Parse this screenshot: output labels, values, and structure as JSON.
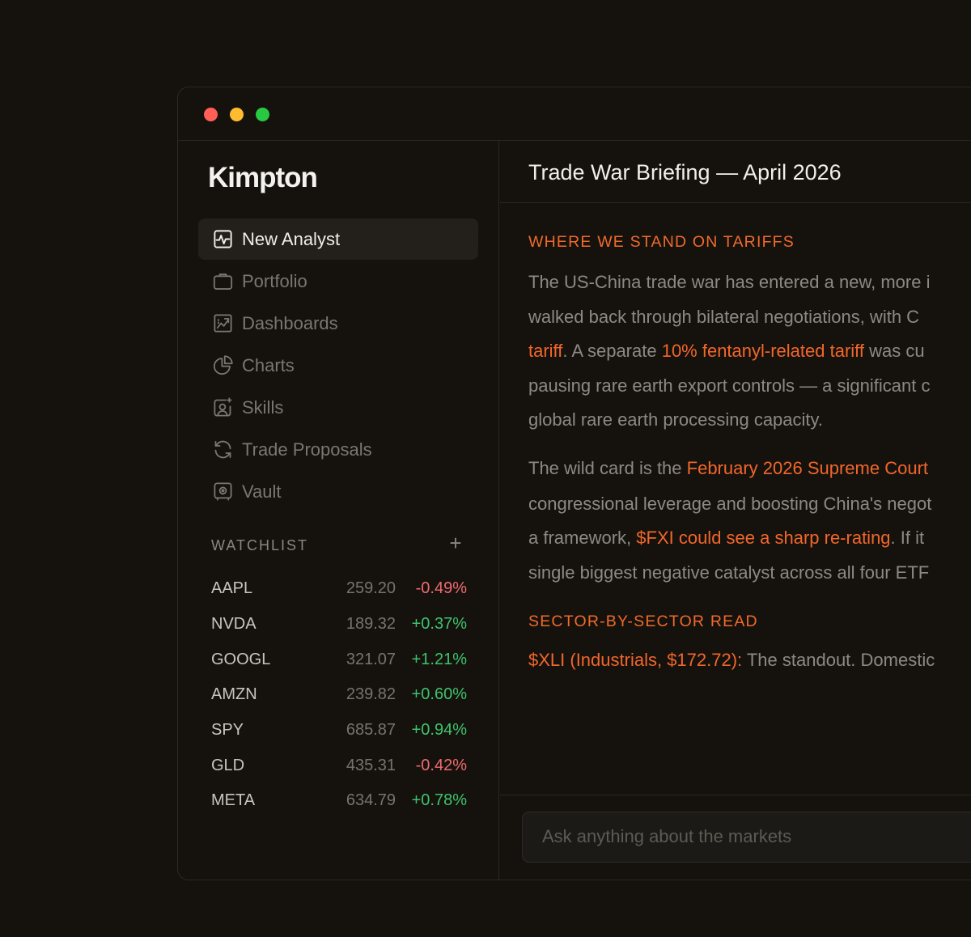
{
  "window": {
    "traffic_lights": [
      "close",
      "minimize",
      "zoom"
    ]
  },
  "sidebar": {
    "logo": "Kimpton",
    "nav": [
      {
        "label": "New Analyst",
        "icon": "chart-line-icon",
        "active": true
      },
      {
        "label": "Portfolio",
        "icon": "briefcase-icon"
      },
      {
        "label": "Dashboards",
        "icon": "dashboard-icon"
      },
      {
        "label": "Charts",
        "icon": "pie-chart-icon"
      },
      {
        "label": "Skills",
        "icon": "user-sparkle-icon"
      },
      {
        "label": "Trade Proposals",
        "icon": "refresh-icon"
      },
      {
        "label": "Vault",
        "icon": "vault-icon"
      }
    ],
    "watchlist": {
      "title": "WATCHLIST",
      "add_label": "+",
      "items": [
        {
          "symbol": "AAPL",
          "price": "259.20",
          "change": "-0.49%",
          "direction": "down"
        },
        {
          "symbol": "NVDA",
          "price": "189.32",
          "change": "+0.37%",
          "direction": "up"
        },
        {
          "symbol": "GOOGL",
          "price": "321.07",
          "change": "+1.21%",
          "direction": "up"
        },
        {
          "symbol": "AMZN",
          "price": "239.82",
          "change": "+0.60%",
          "direction": "up"
        },
        {
          "symbol": "SPY",
          "price": "685.87",
          "change": "+0.94%",
          "direction": "up"
        },
        {
          "symbol": "GLD",
          "price": "435.31",
          "change": "-0.42%",
          "direction": "down"
        },
        {
          "symbol": "META",
          "price": "634.79",
          "change": "+0.78%",
          "direction": "up"
        }
      ]
    }
  },
  "main": {
    "title": "Trade War Briefing — April 2026",
    "section1": {
      "heading": "WHERE WE STAND ON TARIFFS",
      "line1": "The US-China trade war has entered a new, more i",
      "line2": "walked back through bilateral negotiations, with C",
      "line3_hl1": "tariff",
      "line3_t1": ". A separate ",
      "line3_hl2": "10% fentanyl-related tariff",
      "line3_t2": " was cu",
      "line4": "pausing rare earth export controls — a significant c",
      "line5": "global rare earth processing capacity."
    },
    "para2": {
      "line1_t": "The wild card is the ",
      "line1_hl": "February 2026 Supreme Court",
      "line2": "congressional leverage and boosting China's negot",
      "line3_t1": "a framework, ",
      "line3_hl": "$FXI could see a sharp re-rating",
      "line3_t2": ". If it",
      "line4": "single biggest negative catalyst across all four ETF"
    },
    "section2": {
      "heading": "SECTOR-BY-SECTOR READ",
      "line1_hl": "$XLI (Industrials, $172.72):",
      "line1_t": " The standout. Domestic"
    },
    "composer": {
      "placeholder": "Ask anything about the markets"
    }
  },
  "colors": {
    "accent": "#f2662a",
    "up": "#3ec36b",
    "down": "#f06a70",
    "background": "#15120e"
  }
}
